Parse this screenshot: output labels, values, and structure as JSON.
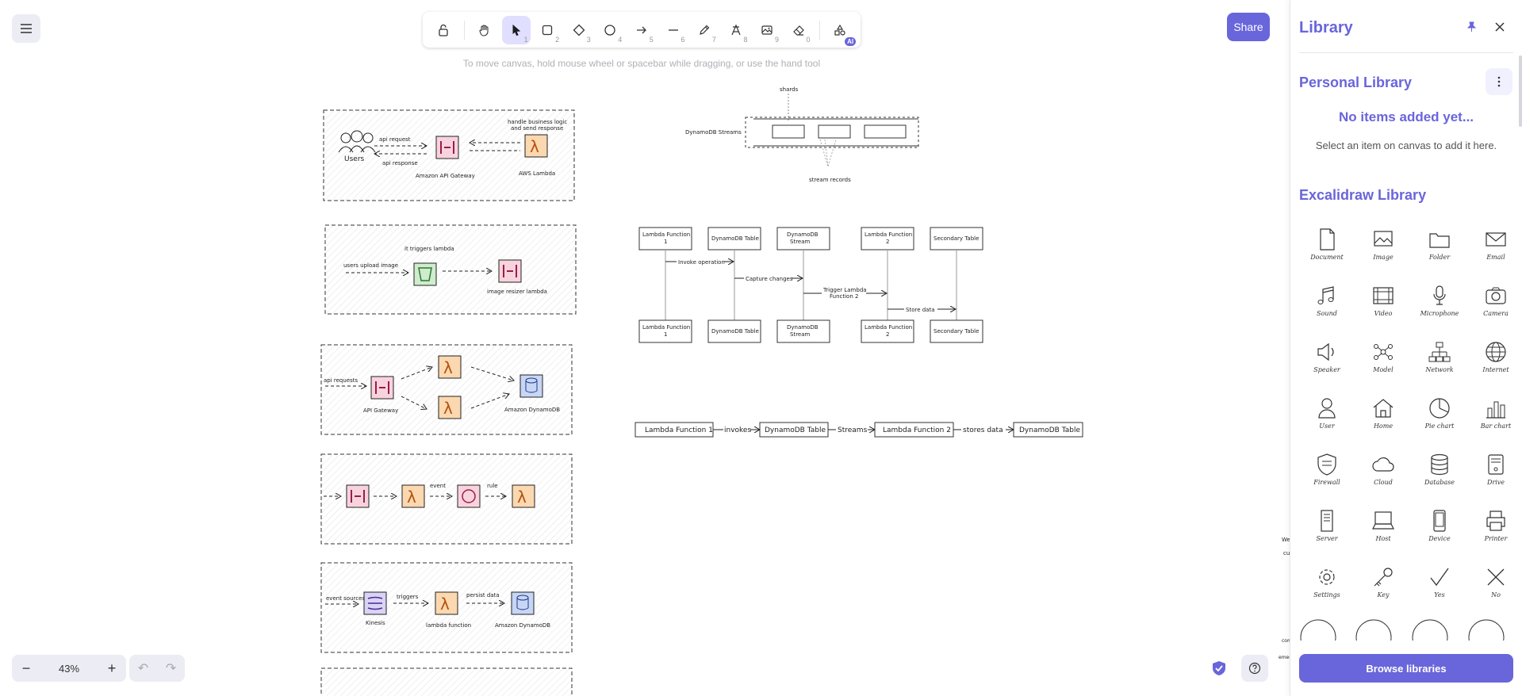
{
  "toolbar": {
    "tools": [
      {
        "name": "lock-tool",
        "key": ""
      },
      {
        "name": "hand-tool",
        "key": ""
      },
      {
        "name": "selection-tool",
        "key": "1"
      },
      {
        "name": "rectangle-tool",
        "key": "2"
      },
      {
        "name": "diamond-tool",
        "key": "3"
      },
      {
        "name": "ellipse-tool",
        "key": "4"
      },
      {
        "name": "arrow-tool",
        "key": "5"
      },
      {
        "name": "line-tool",
        "key": "6"
      },
      {
        "name": "draw-tool",
        "key": "7"
      },
      {
        "name": "text-tool",
        "key": "8"
      },
      {
        "name": "image-tool",
        "key": "9"
      },
      {
        "name": "eraser-tool",
        "key": "0"
      },
      {
        "name": "more-tools",
        "key": ""
      }
    ],
    "ai_badge": "AI",
    "hint": "To move canvas, hold mouse wheel or spacebar while dragging, or use the hand tool"
  },
  "share_label": "Share",
  "zoom": {
    "value": "43%",
    "minus": "−",
    "plus": "+"
  },
  "undo": {
    "undo": "↶",
    "redo": "↷"
  },
  "colors": {
    "accent": "#6965db",
    "accent_soft": "#e0dfff",
    "island": "#ececf4"
  },
  "canvas": {
    "frame1": {
      "users": "Users",
      "api_request": "api request",
      "api_response": "api response",
      "gateway": "Amazon API Gateway",
      "lambda": "AWS Lambda",
      "note1": "handle business logic",
      "note2": "and send response"
    },
    "frame2": {
      "trigger": "it triggers lambda",
      "upload": "users upload image",
      "resizer": "image resizer lambda"
    },
    "frame3": {
      "requests": "api requests",
      "gateway": "API Gateway",
      "dynamo": "Amazon DynamoDB"
    },
    "frame4": {
      "event": "event",
      "rule": "rule"
    },
    "frame5": {
      "sources": "event sources",
      "triggers": "triggers",
      "persist": "persist data",
      "kinesis": "Kinesis",
      "lambda": "lambda function",
      "dynamo": "Amazon DynamoDB"
    },
    "streams": {
      "shards": "shards",
      "label": "DynamoDB Streams",
      "records": "stream records"
    },
    "seq": {
      "h1": "Lambda Function",
      "h1b": "1",
      "h2": "DynamoDB Table",
      "h3": "DynamoDB",
      "h3b": "Stream",
      "h4": "Lambda Function",
      "h4b": "2",
      "h5": "Secondary Table",
      "m1": "Invoke operation",
      "m2": "Capture changes",
      "m3a": "Trigger Lambda",
      "m3b": "Function 2",
      "m4": "Store data"
    },
    "flow": {
      "n1": "Lambda Function 1",
      "e1": "invokes",
      "n2": "DynamoDB Table",
      "e2": "Streams",
      "n3": "Lambda Function 2",
      "e3": "stores data",
      "n4": "DynamoDB Table"
    },
    "edge_text": {
      "a": "We",
      "b": "cu",
      "c": "com",
      "d": "emerget"
    }
  },
  "library": {
    "title": "Library",
    "personal_title": "Personal Library",
    "empty_title": "No items added yet...",
    "empty_sub": "Select an item on canvas to add it here.",
    "excalidraw_title": "Excalidraw Library",
    "items": [
      {
        "label": "Document",
        "icon": "document-icon"
      },
      {
        "label": "Image",
        "icon": "image-icon"
      },
      {
        "label": "Folder",
        "icon": "folder-icon"
      },
      {
        "label": "Email",
        "icon": "email-icon"
      },
      {
        "label": "Sound",
        "icon": "sound-icon"
      },
      {
        "label": "Video",
        "icon": "video-icon"
      },
      {
        "label": "Microphone",
        "icon": "microphone-icon"
      },
      {
        "label": "Camera",
        "icon": "camera-icon"
      },
      {
        "label": "Speaker",
        "icon": "speaker-icon"
      },
      {
        "label": "Model",
        "icon": "model-icon"
      },
      {
        "label": "Network",
        "icon": "network-icon"
      },
      {
        "label": "Internet",
        "icon": "internet-icon"
      },
      {
        "label": "User",
        "icon": "user-icon"
      },
      {
        "label": "Home",
        "icon": "home-icon"
      },
      {
        "label": "Pie chart",
        "icon": "pie-chart-icon"
      },
      {
        "label": "Bar chart",
        "icon": "bar-chart-icon"
      },
      {
        "label": "Firewall",
        "icon": "firewall-icon"
      },
      {
        "label": "Cloud",
        "icon": "cloud-icon"
      },
      {
        "label": "Database",
        "icon": "database-icon"
      },
      {
        "label": "Drive",
        "icon": "drive-icon"
      },
      {
        "label": "Server",
        "icon": "server-icon"
      },
      {
        "label": "Host",
        "icon": "host-icon"
      },
      {
        "label": "Device",
        "icon": "device-icon"
      },
      {
        "label": "Printer",
        "icon": "printer-icon"
      },
      {
        "label": "Settings",
        "icon": "settings-icon"
      },
      {
        "label": "Key",
        "icon": "key-icon"
      },
      {
        "label": "Yes",
        "icon": "check-icon"
      },
      {
        "label": "No",
        "icon": "cross-icon"
      }
    ],
    "browse_label": "Browse libraries"
  }
}
